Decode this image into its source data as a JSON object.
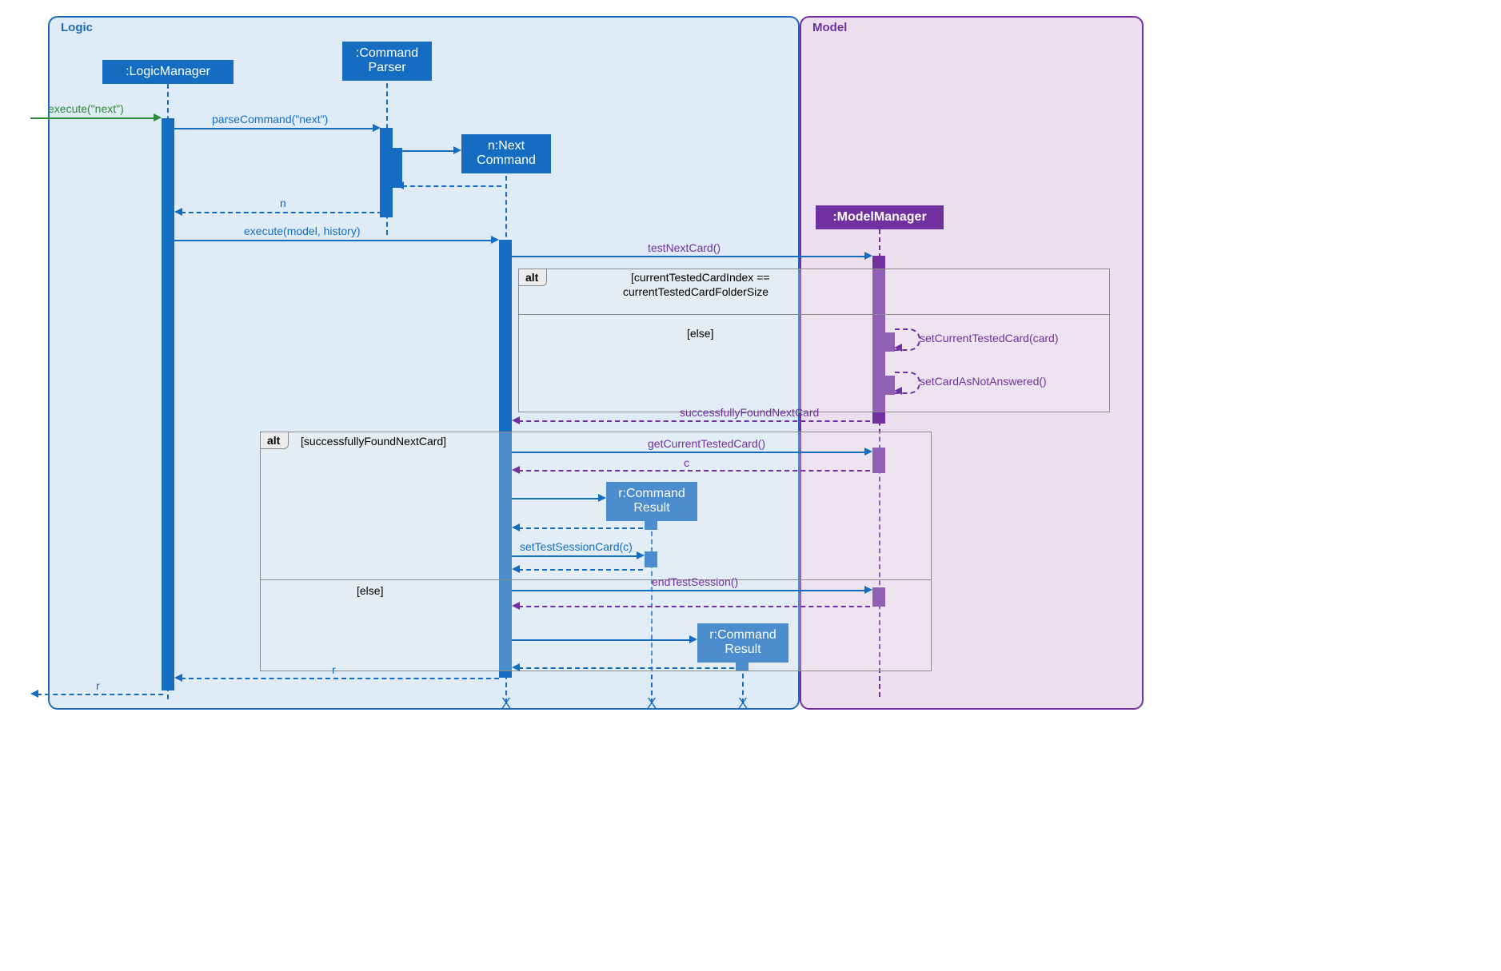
{
  "frames": {
    "logic": "Logic",
    "model": "Model"
  },
  "heads": {
    "logicManager": ":LogicManager",
    "commandParser": ":Command\nParser",
    "nextCommand": "n:Next\nCommand",
    "modelManager": ":ModelManager",
    "commandResult1": "r:Command\nResult",
    "commandResult2": "r:Command\nResult"
  },
  "messages": {
    "executeNext": "execute(\"next\")",
    "parseCommand": "parseCommand(\"next\")",
    "returnN": "n",
    "executeModelHistory": "execute(model, history)",
    "testNextCard": "testNextCard()",
    "setCurrentTestedCard": "setCurrentTestedCard(card)",
    "setCardAsNotAnswered": "setCardAsNotAnswered()",
    "successfullyFoundNextCard": "successfullyFoundNextCard",
    "getCurrentTestedCard": "getCurrentTestedCard()",
    "returnC": "c",
    "setTestSessionCard": "setTestSessionCard(c)",
    "endTestSession": "endTestSession()",
    "returnR": "r",
    "returnROut": "r"
  },
  "alt1": {
    "tag": "alt",
    "guard1a": "[currentTestedCardIndex ==",
    "guard1b": "currentTestedCardFolderSize",
    "guard2": "[else]"
  },
  "alt2": {
    "tag": "alt",
    "guard1": "[successfullyFoundNextCard]",
    "guard2": "[else]"
  },
  "dest": "X"
}
